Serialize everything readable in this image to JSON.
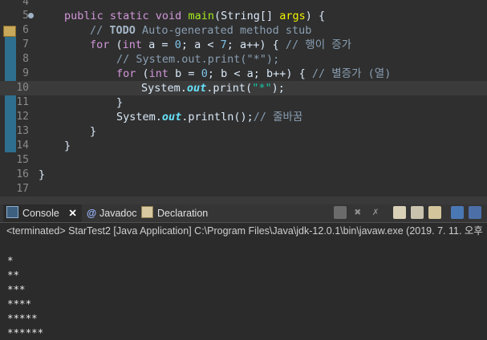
{
  "editor": {
    "lines": [
      {
        "n": "4"
      },
      {
        "n": "5"
      },
      {
        "n": "6"
      },
      {
        "n": "7"
      },
      {
        "n": "8"
      },
      {
        "n": "9"
      },
      {
        "n": "10"
      },
      {
        "n": "11"
      },
      {
        "n": "12"
      },
      {
        "n": "13"
      },
      {
        "n": "14"
      },
      {
        "n": "15"
      },
      {
        "n": "16"
      },
      {
        "n": "17"
      }
    ],
    "code": {
      "l5_a": "public static void ",
      "l5_b": "main",
      "l5_c": "(String[] ",
      "l5_d": "args",
      "l5_e": ") {",
      "l6_a": "// ",
      "l6_b": "TODO",
      "l6_c": " Auto-generated method stub",
      "l7_a": "for",
      "l7_b": " (",
      "l7_c": "int",
      "l7_d": " a = ",
      "l7_e": "0",
      "l7_f": "; a < ",
      "l7_g": "7",
      "l7_h": "; a++) { ",
      "l7_i": "// 행이 증가",
      "l8": "// System.out.print(\"*\");",
      "l9_a": "for",
      "l9_b": " (",
      "l9_c": "int",
      "l9_d": " b = ",
      "l9_e": "0",
      "l9_f": "; b < a; b++) { ",
      "l9_g": "// 별증가 (열)",
      "l10_a": "System.",
      "l10_b": "out",
      "l10_c": ".print(",
      "l10_d": "\"*\"",
      "l10_e": ");",
      "l11": "}",
      "l12_a": "System.",
      "l12_b": "out",
      "l12_c": ".println();",
      "l12_d": "// 줄바꿈",
      "l13": "}",
      "l14": "}",
      "l16": "}"
    }
  },
  "tabs": [
    {
      "label": "Console"
    },
    {
      "label": "Javadoc"
    },
    {
      "label": "Declaration"
    }
  ],
  "status": "<terminated> StarTest2 [Java Application] C:\\Program Files\\Java\\jdk-12.0.1\\bin\\javaw.exe (2019. 7. 11. 오후",
  "output": [
    "",
    "*",
    "**",
    "***",
    "****",
    "*****",
    "******"
  ],
  "colors": {
    "accent": "#2e6f8f",
    "keyword": "#d197d9",
    "string": "#17c6a3",
    "comment": "#8a9fb3"
  }
}
